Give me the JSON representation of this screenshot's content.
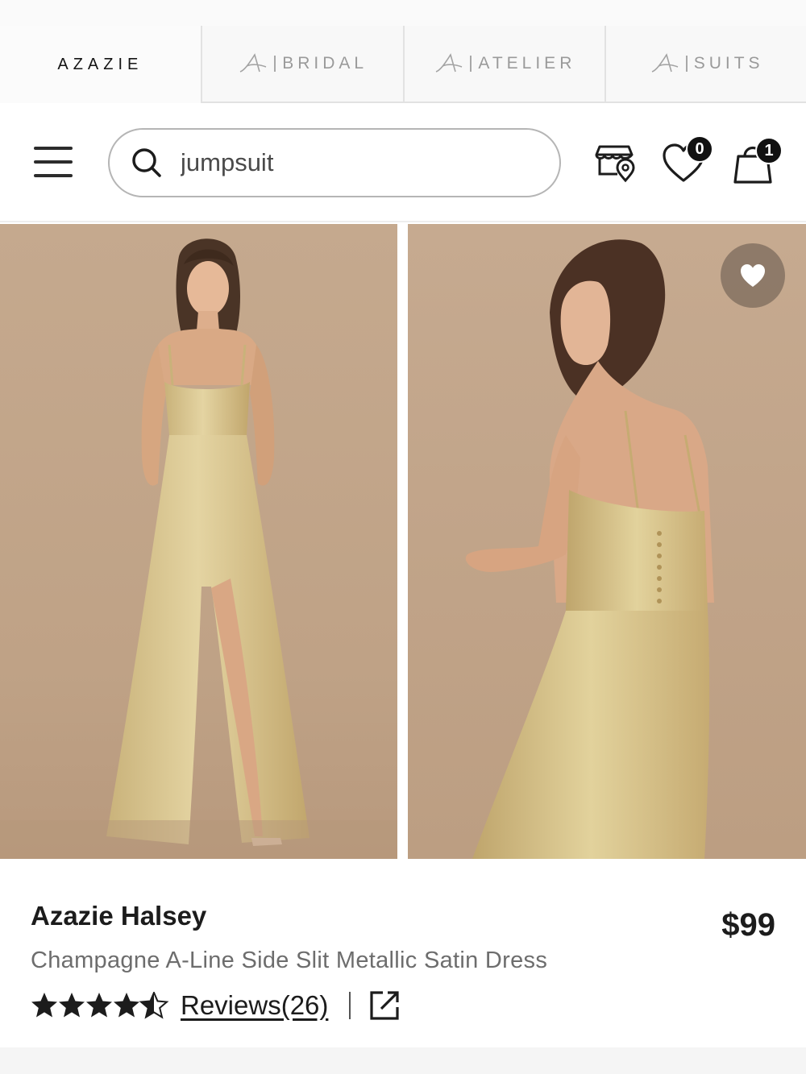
{
  "brand_tabs": [
    {
      "label": "AZAZIE",
      "active": true
    },
    {
      "label": "BRIDAL",
      "active": false
    },
    {
      "label": "ATELIER",
      "active": false
    },
    {
      "label": "SUITS",
      "active": false
    }
  ],
  "header": {
    "search_value": "jumpsuit",
    "wishlist_count": "0",
    "cart_count": "1"
  },
  "product": {
    "name": "Azazie Halsey",
    "price": "$99",
    "description": "Champagne A-Line Side Slit Metallic Satin Dress",
    "rating": 4.5,
    "reviews_label": "Reviews(26)"
  },
  "colors": {
    "backdrop": "#c4a88c",
    "dress": "#d8c48e",
    "text_dark": "#1c1c1c",
    "text_muted": "#6d6d6d"
  }
}
